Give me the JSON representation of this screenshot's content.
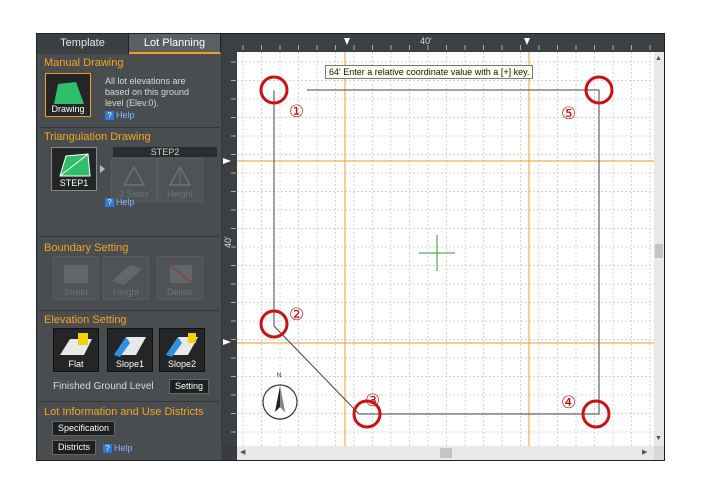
{
  "tabs": [
    {
      "label": "Template"
    },
    {
      "label": "Lot Planning"
    }
  ],
  "manual": {
    "title": "Manual Drawing",
    "tool": "Drawing",
    "note_lines": [
      "All lot elevations are",
      "based on this ground",
      "level (Elev.0)."
    ],
    "help": "Help"
  },
  "triangulation": {
    "title": "Triangulation Drawing",
    "step_label": "STEP2",
    "tools": [
      "STEP1",
      "3 Sides",
      "Height"
    ],
    "help": "Help"
  },
  "boundary": {
    "title": "Boundary Setting",
    "tools": [
      "Street",
      "Height",
      "Delete"
    ]
  },
  "elevation": {
    "title": "Elevation Setting",
    "tools": [
      "Flat",
      "Slope1",
      "Slope2"
    ],
    "finished_label": "Finished Ground Level",
    "setting_button": "Setting"
  },
  "lot_info": {
    "title": "Lot Information and Use Districts",
    "spec_button": "Specification",
    "districts_button": "Districts",
    "help": "Help"
  },
  "ruler": {
    "top_label": "40'",
    "left_label": "40'"
  },
  "tooltip": "64' Enter a relative coordinate value with a [+] key.",
  "markers": [
    "①",
    "②",
    "③",
    "④",
    "⑤"
  ],
  "compass": "N",
  "colors": {
    "accent": "#f3a51f",
    "guide": "#e8a21a",
    "marker": "#cc1111",
    "cursor": "#2e9a2e"
  }
}
